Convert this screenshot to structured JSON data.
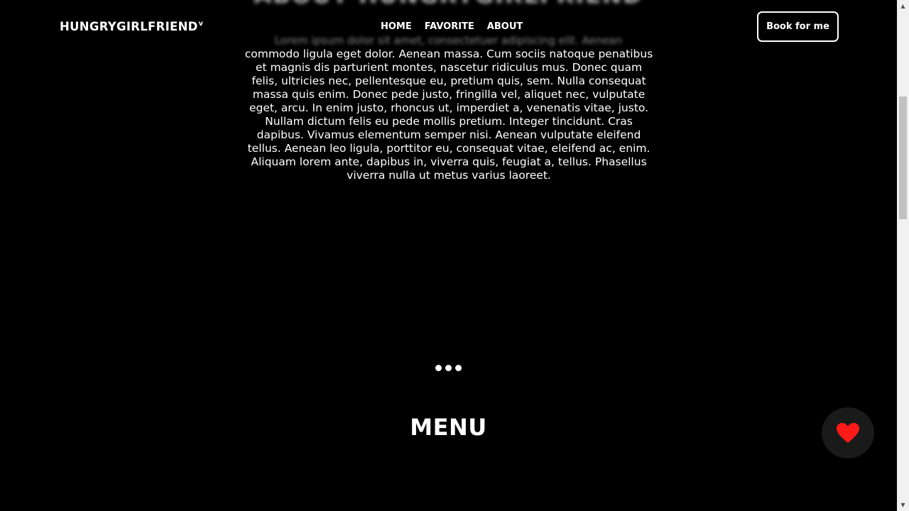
{
  "header": {
    "logo": "HUNGRYGIRLFRIEND",
    "logo_mark": "v",
    "nav": [
      "HOME",
      "FAVORITE",
      "ABOUT"
    ],
    "book_button": "Book for me"
  },
  "about": {
    "blurred_title": "ABOUT HUNGRYGIRLFRIEND",
    "blurred_first_line": "Lorem ipsum dolor sit amet, consectetuer adipiscing elit. Aenean",
    "lines": [
      "commodo ligula eget dolor. Aenean massa. Cum sociis natoque penatibus",
      "et magnis dis parturient montes, nascetur ridiculus mus. Donec quam",
      "felis, ultricies nec, pellentesque eu, pretium quis, sem. Nulla consequat",
      "massa quis enim. Donec pede justo, fringilla vel, aliquet nec, vulputate",
      "eget, arcu. In enim justo, rhoncus ut, imperdiet a, venenatis vitae, justo.",
      "Nullam dictum felis eu pede mollis pretium. Integer tincidunt. Cras",
      "dapibus. Vivamus elementum semper nisi. Aenean vulputate eleifend",
      "tellus. Aenean leo ligula, porttitor eu, consequat vitae, eleifend ac, enim.",
      "Aliquam lorem ante, dapibus in, viverra quis, feugiat a, tellus. Phasellus",
      "viverra nulla ut metus varius laoreet."
    ]
  },
  "menu": {
    "title": "MENU"
  },
  "fab": {
    "icon": "heart-icon",
    "color": "#ff1a1a"
  },
  "colors": {
    "background": "#000000",
    "text": "#ffffff",
    "fab_background": "#1a1a1a"
  }
}
